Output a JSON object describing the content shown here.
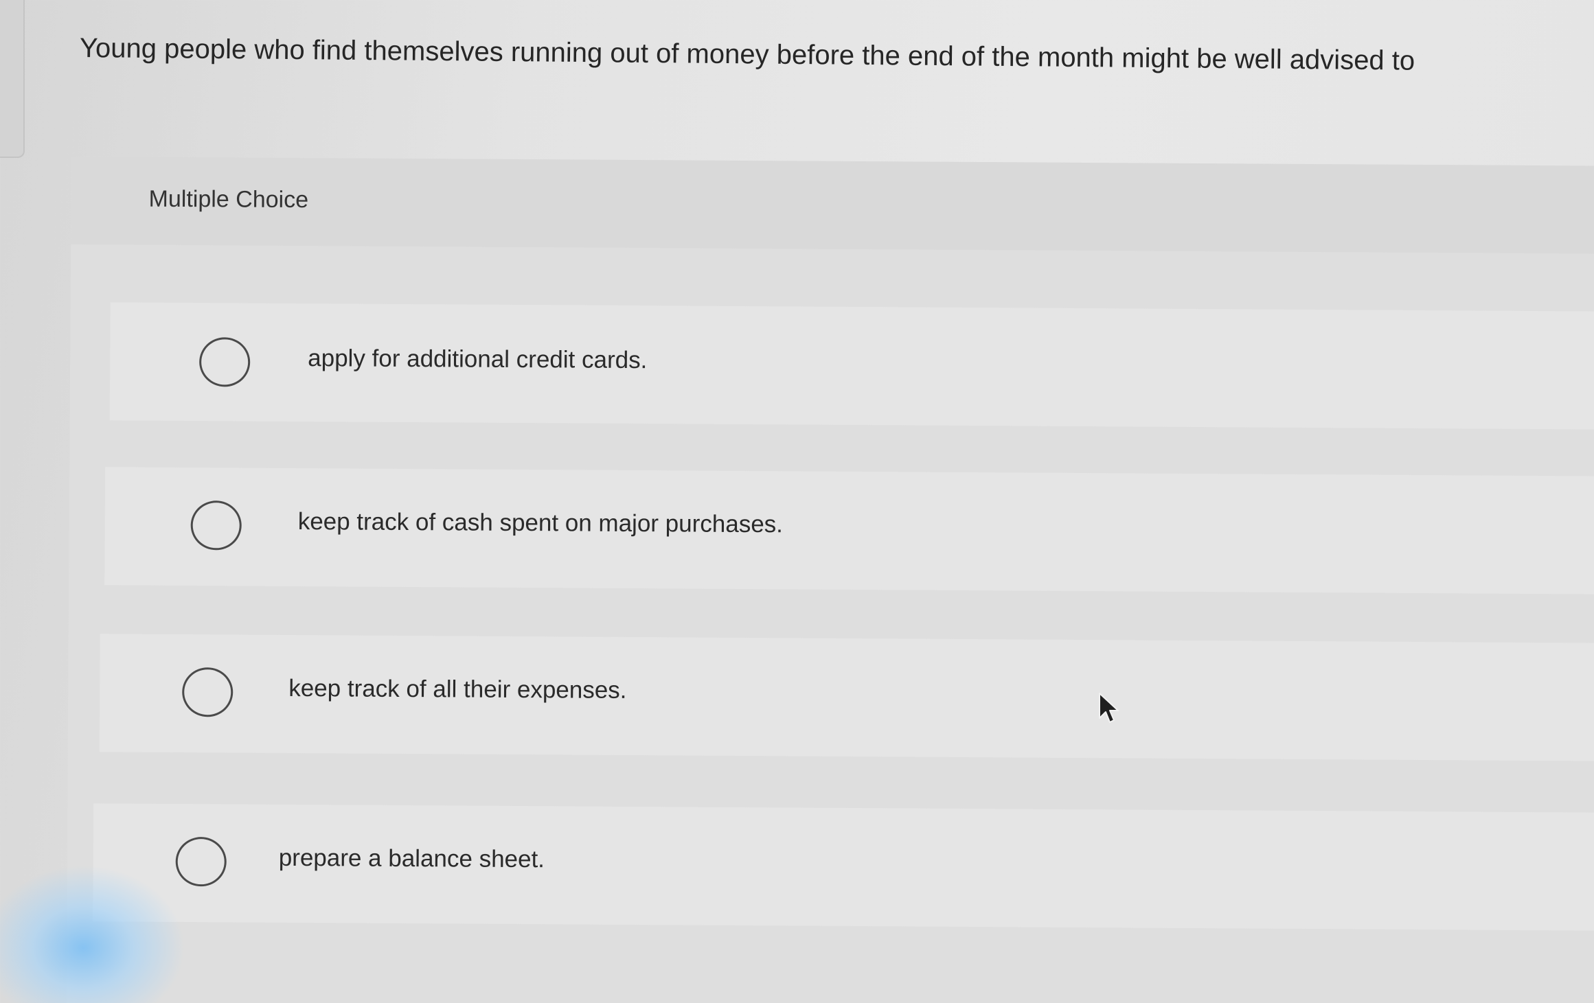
{
  "question": {
    "text": "Young people who find themselves running out of money before the end of the month might be well advised to"
  },
  "answer_panel": {
    "header_label": "Multiple Choice",
    "options": [
      {
        "label": "apply for additional credit cards.",
        "selected": false
      },
      {
        "label": "keep track of cash spent on major purchases.",
        "selected": false
      },
      {
        "label": "keep track of all their expenses.",
        "selected": false
      },
      {
        "label": "prepare a balance sheet.",
        "selected": false
      }
    ]
  },
  "icons": {
    "radio": "radio-button-empty-icon",
    "cursor": "mouse-pointer-icon"
  },
  "colors": {
    "background": "#e3e3e3",
    "panel": "#dedede",
    "option_row": "#e5e5e5",
    "text": "#2a2a2a",
    "radio_border": "#4a4a4a"
  }
}
